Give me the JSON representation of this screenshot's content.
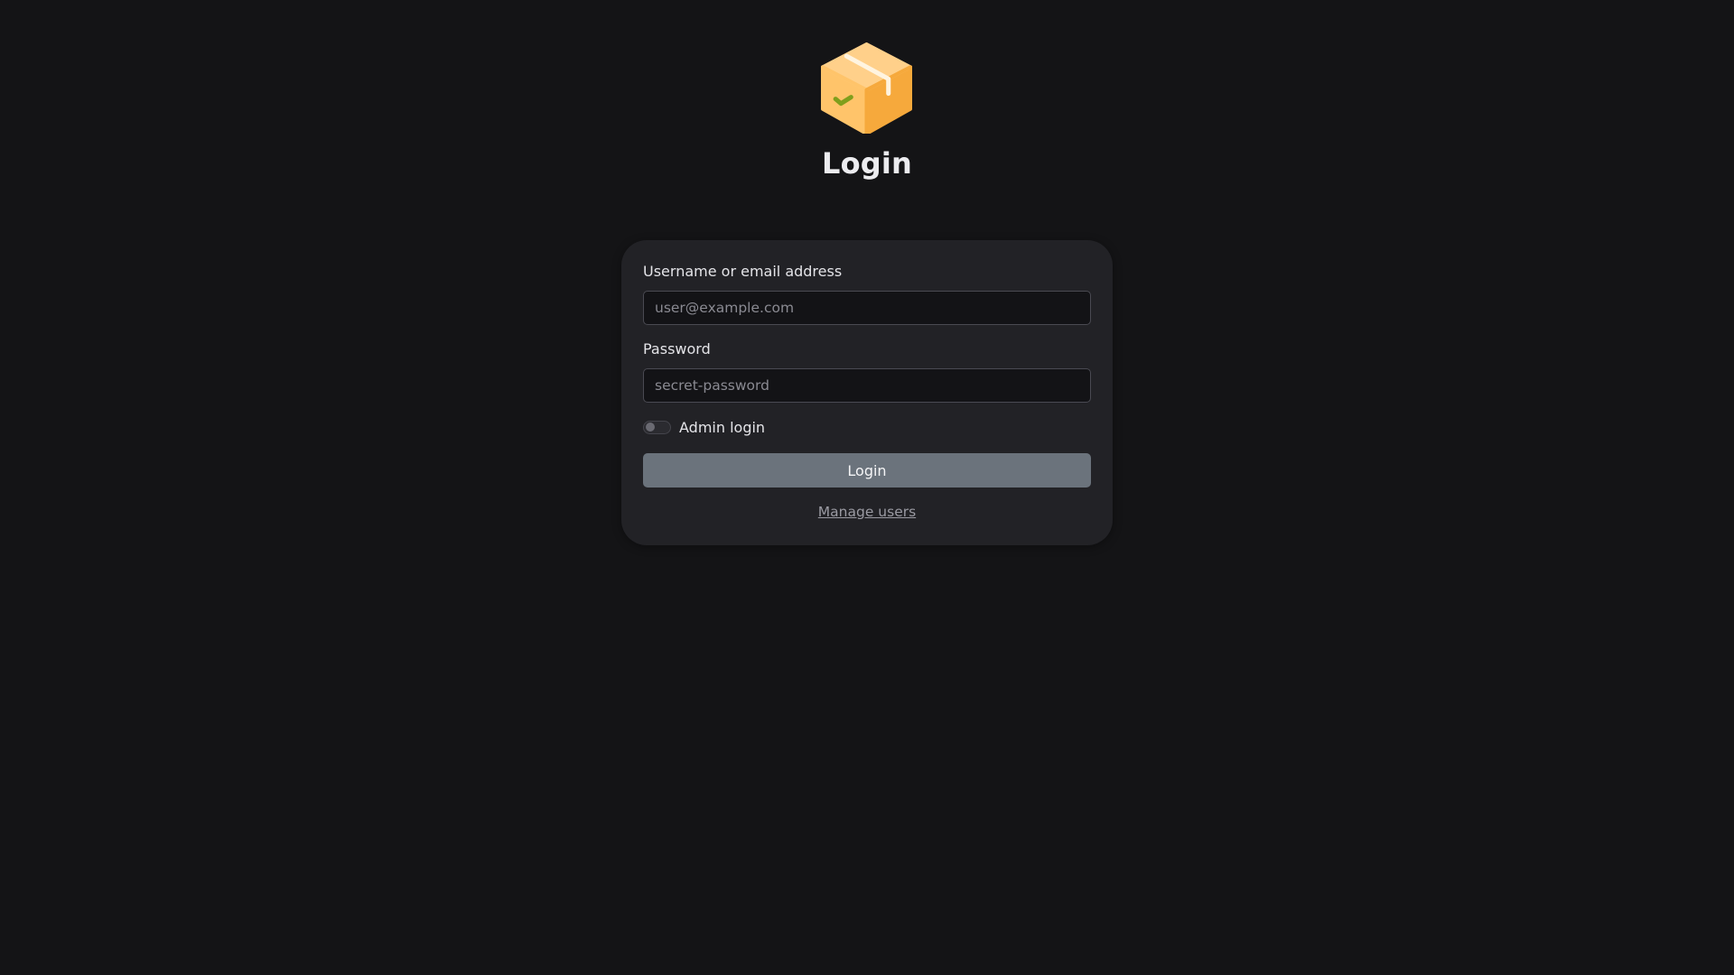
{
  "app": {
    "title": "Login",
    "logo_icon": "package-box-icon"
  },
  "form": {
    "username_label": "Username or email address",
    "username_placeholder": "user@example.com",
    "username_value": "",
    "password_label": "Password",
    "password_placeholder": "secret-password",
    "password_value": "",
    "admin_toggle_label": "Admin login",
    "admin_toggle_on": false,
    "submit_label": "Login",
    "manage_users_link": "Manage users"
  },
  "colors": {
    "background": "#141416",
    "card": "#222226",
    "button": "#6b737c",
    "logo_box": "#fbb451",
    "logo_check": "#7f9f1c"
  }
}
